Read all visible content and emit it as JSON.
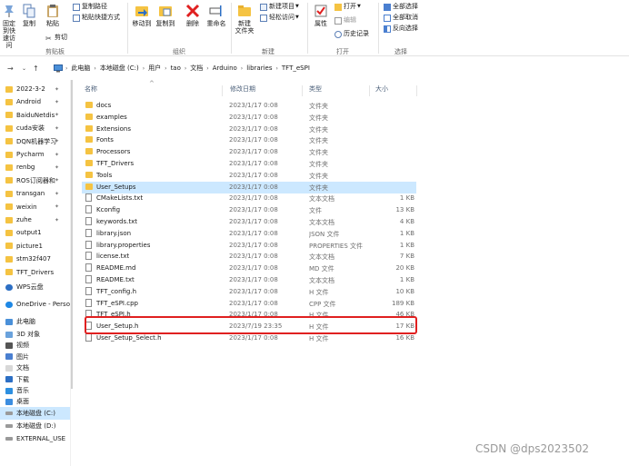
{
  "ribbon": {
    "clipboard": {
      "pin_quick_access": "固定到快",
      "pin_quick_access_2": "速访问",
      "copy": "复制",
      "paste": "粘贴",
      "copy_path": "复制路径",
      "paste_shortcut": "粘贴快捷方式",
      "cut": "剪切",
      "label": "剪贴板"
    },
    "organize": {
      "move_to": "移动到",
      "copy_to": "复制到",
      "delete": "删除",
      "rename": "重命名",
      "label": "组织"
    },
    "new": {
      "new_folder": "新建",
      "new_folder_2": "文件夹",
      "new_item": "新建项目",
      "easy_access": "轻松访问",
      "label": "新建"
    },
    "open": {
      "properties": "属性",
      "open": "打开",
      "edit": "编辑",
      "history": "历史记录",
      "label": "打开"
    },
    "select": {
      "select_all": "全部选择",
      "select_none": "全部取消",
      "invert": "反向选择",
      "label": "选择"
    }
  },
  "address": {
    "crumbs": [
      "此电脑",
      "本地磁盘 (C:)",
      "用户",
      "tao",
      "文档",
      "Arduino",
      "libraries",
      "TFT_eSPI"
    ]
  },
  "sidebar": {
    "quick": [
      {
        "label": "2022-3-2",
        "pin": "✦"
      },
      {
        "label": "Android",
        "pin": "✦"
      },
      {
        "label": "BaiduNetdis",
        "pin": "✦"
      },
      {
        "label": "cuda安装",
        "pin": "✦"
      },
      {
        "label": "DQN机器学习",
        "pin": "✦"
      },
      {
        "label": "Pycharm",
        "pin": "✦"
      },
      {
        "label": "renbg",
        "pin": "✦"
      },
      {
        "label": "ROS订阅器和",
        "pin": "✦"
      },
      {
        "label": "transgan",
        "pin": "✦"
      },
      {
        "label": "weixin",
        "pin": "✦"
      },
      {
        "label": "zuhe",
        "pin": "✦"
      },
      {
        "label": "output1",
        "pin": ""
      },
      {
        "label": "picture1",
        "pin": ""
      },
      {
        "label": "stm32f407",
        "pin": ""
      },
      {
        "label": "TFT_Drivers",
        "pin": ""
      }
    ],
    "wps": "WPS云盘",
    "onedrive": "OneDrive - Perso",
    "thispc": "此电脑",
    "pc_items": [
      "3D 对象",
      "视频",
      "图片",
      "文档",
      "下载",
      "音乐",
      "桌面"
    ],
    "drives": [
      "本地磁盘 (C:)",
      "本地磁盘 (D:)",
      "EXTERNAL_USE"
    ]
  },
  "columns": {
    "name": "名称",
    "date": "修改日期",
    "type": "类型",
    "size": "大小"
  },
  "files": [
    {
      "name": "docs",
      "date": "2023/1/17 0:08",
      "type": "文件夹",
      "size": "",
      "kind": "folder"
    },
    {
      "name": "examples",
      "date": "2023/1/17 0:08",
      "type": "文件夹",
      "size": "",
      "kind": "folder"
    },
    {
      "name": "Extensions",
      "date": "2023/1/17 0:08",
      "type": "文件夹",
      "size": "",
      "kind": "folder"
    },
    {
      "name": "Fonts",
      "date": "2023/1/17 0:08",
      "type": "文件夹",
      "size": "",
      "kind": "folder"
    },
    {
      "name": "Processors",
      "date": "2023/1/17 0:08",
      "type": "文件夹",
      "size": "",
      "kind": "folder"
    },
    {
      "name": "TFT_Drivers",
      "date": "2023/1/17 0:08",
      "type": "文件夹",
      "size": "",
      "kind": "folder"
    },
    {
      "name": "Tools",
      "date": "2023/1/17 0:08",
      "type": "文件夹",
      "size": "",
      "kind": "folder"
    },
    {
      "name": "User_Setups",
      "date": "2023/1/17 0:08",
      "type": "文件夹",
      "size": "",
      "kind": "folder"
    },
    {
      "name": "CMakeLists.txt",
      "date": "2023/1/17 0:08",
      "type": "文本文档",
      "size": "1 KB",
      "kind": "file"
    },
    {
      "name": "Kconfig",
      "date": "2023/1/17 0:08",
      "type": "文件",
      "size": "13 KB",
      "kind": "file"
    },
    {
      "name": "keywords.txt",
      "date": "2023/1/17 0:08",
      "type": "文本文档",
      "size": "4 KB",
      "kind": "file"
    },
    {
      "name": "library.json",
      "date": "2023/1/17 0:08",
      "type": "JSON 文件",
      "size": "1 KB",
      "kind": "file"
    },
    {
      "name": "library.properties",
      "date": "2023/1/17 0:08",
      "type": "PROPERTIES 文件",
      "size": "1 KB",
      "kind": "file"
    },
    {
      "name": "license.txt",
      "date": "2023/1/17 0:08",
      "type": "文本文档",
      "size": "7 KB",
      "kind": "file"
    },
    {
      "name": "README.md",
      "date": "2023/1/17 0:08",
      "type": "MD 文件",
      "size": "20 KB",
      "kind": "file"
    },
    {
      "name": "README.txt",
      "date": "2023/1/17 0:08",
      "type": "文本文档",
      "size": "1 KB",
      "kind": "file"
    },
    {
      "name": "TFT_config.h",
      "date": "2023/1/17 0:08",
      "type": "H 文件",
      "size": "10 KB",
      "kind": "file"
    },
    {
      "name": "TFT_eSPI.cpp",
      "date": "2023/1/17 0:08",
      "type": "CPP 文件",
      "size": "189 KB",
      "kind": "file"
    },
    {
      "name": "TFT_eSPI.h",
      "date": "2023/1/17 0:08",
      "type": "H 文件",
      "size": "46 KB",
      "kind": "file"
    },
    {
      "name": "User_Setup.h",
      "date": "2023/7/19 23:35",
      "type": "H 文件",
      "size": "17 KB",
      "kind": "file"
    },
    {
      "name": "User_Setup_Select.h",
      "date": "2023/1/17 0:08",
      "type": "H 文件",
      "size": "16 KB",
      "kind": "file"
    }
  ],
  "watermark": "CSDN @dps2023502",
  "colors": {
    "folder": "#f5c342",
    "selection": "#cce8ff",
    "highlight": "#e02020",
    "delete": "#e02020"
  }
}
